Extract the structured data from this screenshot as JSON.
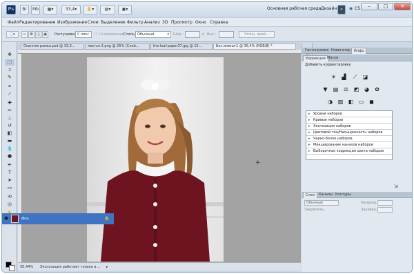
{
  "app": {
    "logo": "Ps",
    "zoom": "33,4",
    "workspace_label": "Основная рабочая среда",
    "design_label": "Дизайн",
    "more_label": "»",
    "cslive_label": "CS Live"
  },
  "window_buttons": {
    "minimize": "–",
    "maximize": "□",
    "close": "✕"
  },
  "menu": [
    "Файл",
    "Редактирование",
    "Изображение",
    "Слои",
    "Выделение",
    "Фильтр",
    "Анализ",
    "3D",
    "Просмотр",
    "Окно",
    "Справка"
  ],
  "options_bar": {
    "feather_label": "Растушевка:",
    "feather_value": "0 пикс",
    "smooth_label": "Сглаживание",
    "style_label": "Стиль:",
    "style_value": "Обычный",
    "width_label": "Шир.:",
    "height_label": "Выс.:",
    "refine_button": "Уточн. край..."
  },
  "doc_tabs": [
    "Осенняя рамка.psd @ 33,3...",
    "листья 2.png @ 25% (Слой...",
    "the-leaf-paper37.jpg @ 15...",
    "Без имени-1 @ 35,4% (RGB/8) *"
  ],
  "status": {
    "zoom": "35,44%",
    "message": "Экспозиция работает только в ..."
  },
  "panel_tabs": [
    "Гистограмма",
    "Навигатор",
    "Инфо"
  ],
  "adj_tabs": [
    "Коррекция",
    "Маски"
  ],
  "adj_title": "Добавить корректировку",
  "presets": [
    "Уровни наборов",
    "Кривые наборов",
    "Экспозиция наборов",
    "Цветовой тон/Насыщенность наборов",
    "Черно-белое наборов",
    "Микширование каналов наборов",
    "Выборочная коррекция цвета наборов"
  ],
  "layers_tabs": [
    "Слои",
    "Каналы",
    "Контуры"
  ],
  "layers": {
    "blend_mode": "Обычные",
    "opacity_label": "Непрозр.:",
    "fill_label": "Заливка:",
    "lock_label": "Закрепить:",
    "layer_name": "Фон"
  },
  "colors": {
    "selection": "#3f74c2",
    "canvas": "#a3a3a3",
    "dress": "#6e1420"
  }
}
